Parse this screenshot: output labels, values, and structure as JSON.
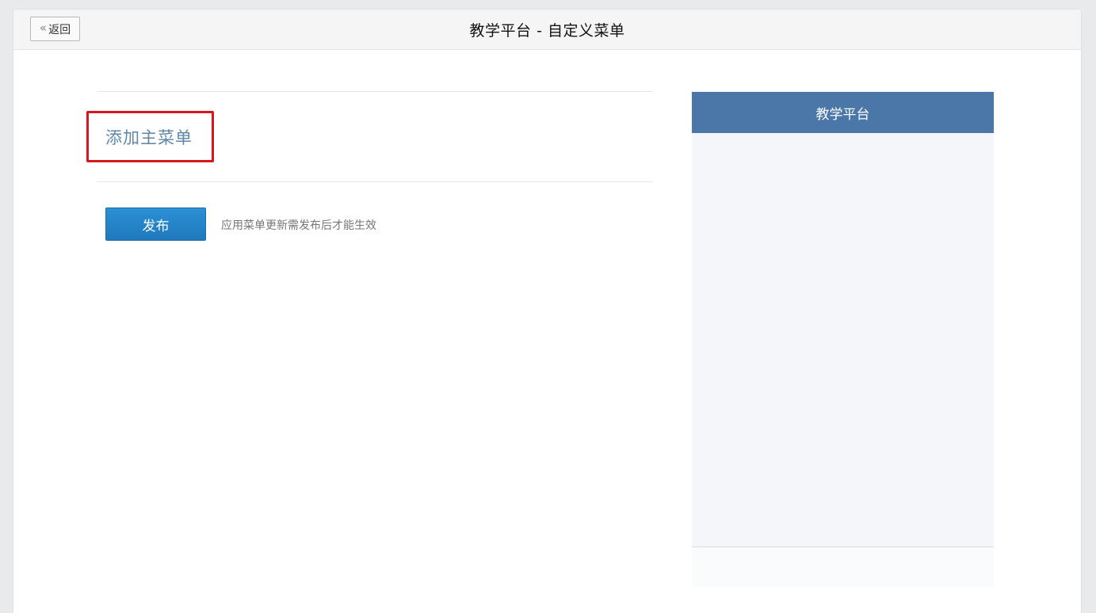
{
  "header": {
    "back_label": "返回",
    "back_icon": "double-chevron-left-icon",
    "title": "教学平台 - 自定义菜单"
  },
  "editor": {
    "add_main_menu_label": "添加主菜单",
    "publish_label": "发布",
    "publish_hint": "应用菜单更新需发布后才能生效"
  },
  "preview": {
    "title": "教学平台"
  },
  "colors": {
    "highlight_box": "#d9161d",
    "publish_button": "#1f7fc2",
    "preview_header": "#4a77a7",
    "add_menu_link": "#5f86a8"
  }
}
